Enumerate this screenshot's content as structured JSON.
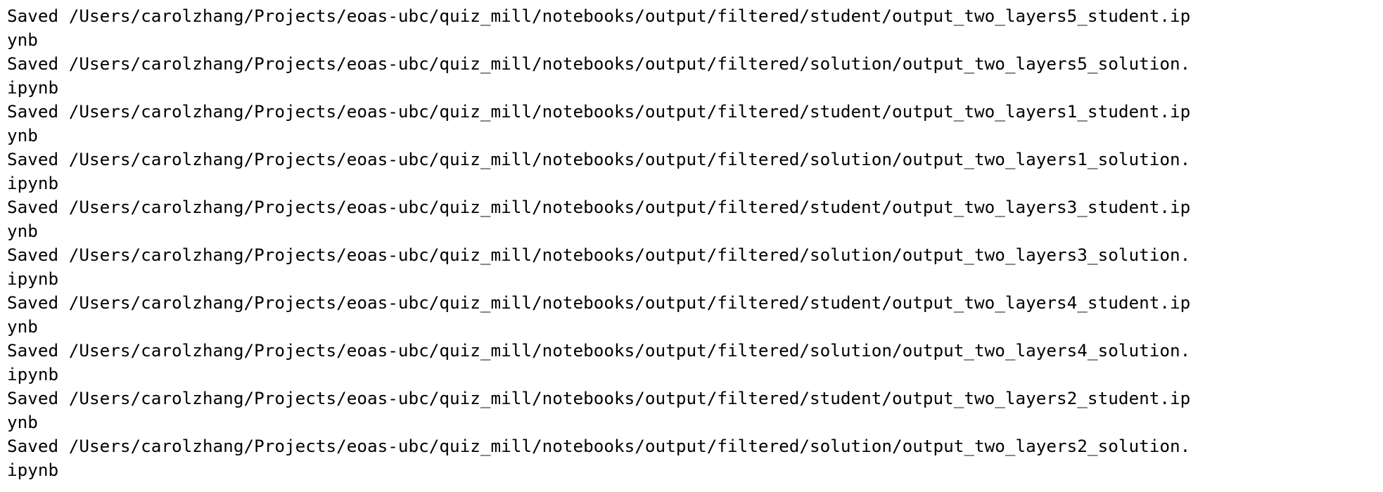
{
  "terminal": {
    "lines": [
      "Saved /Users/carolzhang/Projects/eoas-ubc/quiz_mill/notebooks/output/filtered/student/output_two_layers5_student.ip",
      "ynb",
      "Saved /Users/carolzhang/Projects/eoas-ubc/quiz_mill/notebooks/output/filtered/solution/output_two_layers5_solution.",
      "ipynb",
      "Saved /Users/carolzhang/Projects/eoas-ubc/quiz_mill/notebooks/output/filtered/student/output_two_layers1_student.ip",
      "ynb",
      "Saved /Users/carolzhang/Projects/eoas-ubc/quiz_mill/notebooks/output/filtered/solution/output_two_layers1_solution.",
      "ipynb",
      "Saved /Users/carolzhang/Projects/eoas-ubc/quiz_mill/notebooks/output/filtered/student/output_two_layers3_student.ip",
      "ynb",
      "Saved /Users/carolzhang/Projects/eoas-ubc/quiz_mill/notebooks/output/filtered/solution/output_two_layers3_solution.",
      "ipynb",
      "Saved /Users/carolzhang/Projects/eoas-ubc/quiz_mill/notebooks/output/filtered/student/output_two_layers4_student.ip",
      "ynb",
      "Saved /Users/carolzhang/Projects/eoas-ubc/quiz_mill/notebooks/output/filtered/solution/output_two_layers4_solution.",
      "ipynb",
      "Saved /Users/carolzhang/Projects/eoas-ubc/quiz_mill/notebooks/output/filtered/student/output_two_layers2_student.ip",
      "ynb",
      "Saved /Users/carolzhang/Projects/eoas-ubc/quiz_mill/notebooks/output/filtered/solution/output_two_layers2_solution.",
      "ipynb"
    ]
  }
}
